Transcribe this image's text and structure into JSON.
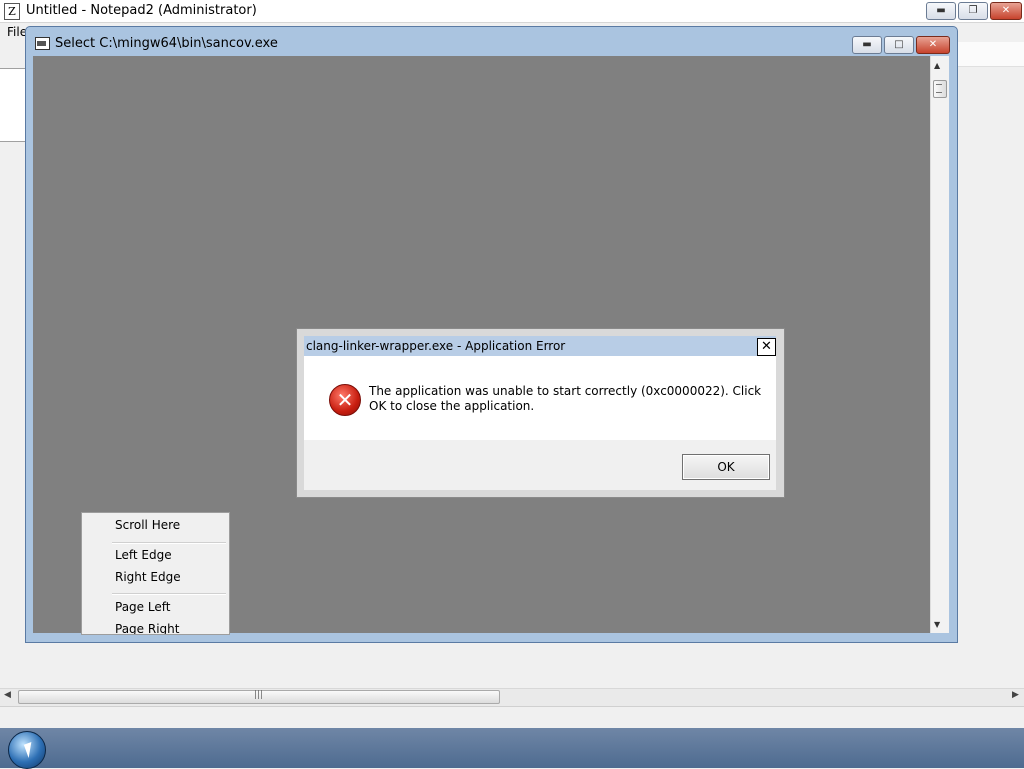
{
  "notepad": {
    "title": "Untitled - Notepad2 (Administrator)",
    "icon_glyph": "Z",
    "menu": {
      "file_label": "File"
    },
    "caption": {
      "minimize": "▬",
      "restore": "❐",
      "close": "✕"
    },
    "hscroll": {
      "left": "◀",
      "right": "▶",
      "grip": "|||"
    }
  },
  "select_window": {
    "title": "Select C:\\mingw64\\bin\\sancov.exe",
    "caption": {
      "minimize": "▬",
      "maximize": "□",
      "close": "✕"
    },
    "vscroll": {
      "up": "▲",
      "down": "▼"
    }
  },
  "context_menu": {
    "items": [
      "Scroll Here",
      "Left Edge",
      "Right Edge",
      "Page Left",
      "Page Right"
    ]
  },
  "error_dialog": {
    "title": "clang-linker-wrapper.exe - Application Error",
    "close_glyph": "✕",
    "icon_glyph": "✕",
    "message": "The application was unable to start correctly (0xc0000022). Click OK to close the application.",
    "ok_label": "OK"
  },
  "icons": [
    "notepad2-icon",
    "console-window-icon",
    "error-icon",
    "windows-start-orb-icon"
  ],
  "colors": {
    "error_red": "#c81e10",
    "client_gray": "#808080",
    "title_blue": "#b8cde6"
  }
}
